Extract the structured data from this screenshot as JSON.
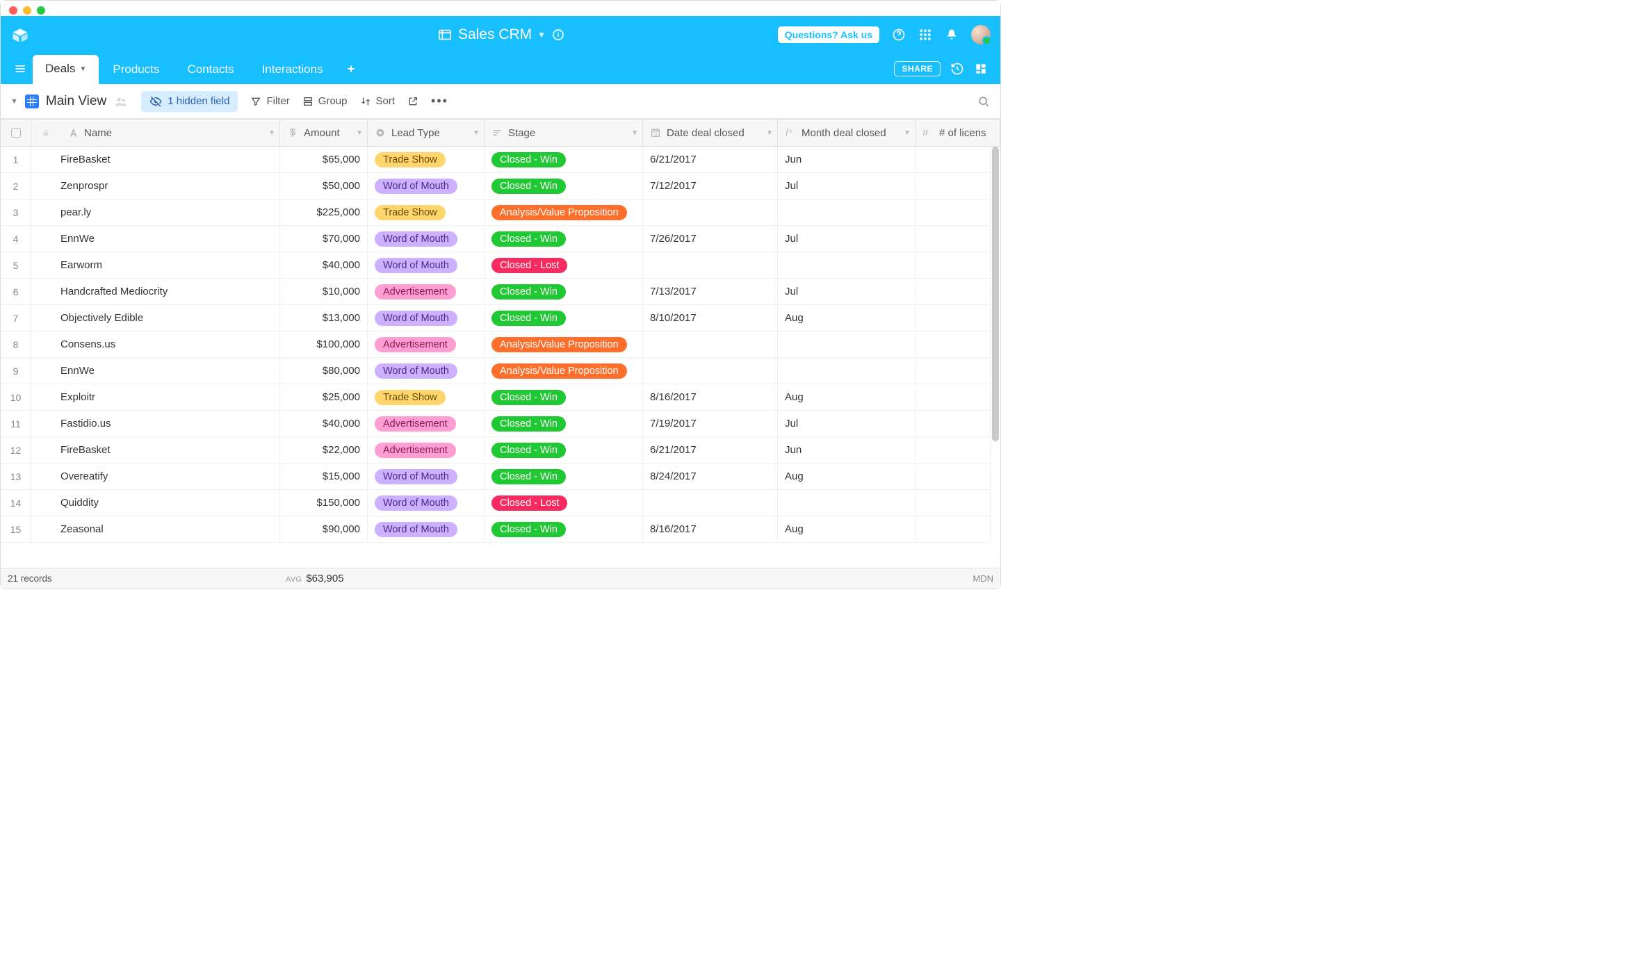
{
  "app": {
    "title": "Sales CRM"
  },
  "header": {
    "ask_label": "Questions? Ask us"
  },
  "tabs": {
    "items": [
      "Deals",
      "Products",
      "Contacts",
      "Interactions"
    ],
    "active": "Deals",
    "share_label": "SHARE"
  },
  "toolbar": {
    "view_name": "Main View",
    "hidden_fields": "1 hidden field",
    "filter": "Filter",
    "group": "Group",
    "sort": "Sort"
  },
  "columns": {
    "name": "Name",
    "amount": "Amount",
    "lead": "Lead Type",
    "stage": "Stage",
    "date": "Date deal closed",
    "month": "Month deal closed",
    "licenses": "# of licens"
  },
  "lead_classes": {
    "Trade Show": "lead-trade",
    "Word of Mouth": "lead-word",
    "Advertisement": "lead-ad"
  },
  "stage_classes": {
    "Closed - Win": "stage-win",
    "Closed - Lost": "stage-lost",
    "Analysis/Value Proposition": "stage-avp"
  },
  "rows": [
    {
      "n": 1,
      "name": "FireBasket",
      "amount": "$65,000",
      "lead": "Trade Show",
      "stage": "Closed - Win",
      "date": "6/21/2017",
      "month": "Jun"
    },
    {
      "n": 2,
      "name": "Zenprospr",
      "amount": "$50,000",
      "lead": "Word of Mouth",
      "stage": "Closed - Win",
      "date": "7/12/2017",
      "month": "Jul"
    },
    {
      "n": 3,
      "name": "pear.ly",
      "amount": "$225,000",
      "lead": "Trade Show",
      "stage": "Analysis/Value Proposition",
      "date": "",
      "month": ""
    },
    {
      "n": 4,
      "name": "EnnWe",
      "amount": "$70,000",
      "lead": "Word of Mouth",
      "stage": "Closed - Win",
      "date": "7/26/2017",
      "month": "Jul"
    },
    {
      "n": 5,
      "name": "Earworm",
      "amount": "$40,000",
      "lead": "Word of Mouth",
      "stage": "Closed - Lost",
      "date": "",
      "month": ""
    },
    {
      "n": 6,
      "name": "Handcrafted Mediocrity",
      "amount": "$10,000",
      "lead": "Advertisement",
      "stage": "Closed - Win",
      "date": "7/13/2017",
      "month": "Jul"
    },
    {
      "n": 7,
      "name": "Objectively Edible",
      "amount": "$13,000",
      "lead": "Word of Mouth",
      "stage": "Closed - Win",
      "date": "8/10/2017",
      "month": "Aug"
    },
    {
      "n": 8,
      "name": "Consens.us",
      "amount": "$100,000",
      "lead": "Advertisement",
      "stage": "Analysis/Value Proposition",
      "date": "",
      "month": ""
    },
    {
      "n": 9,
      "name": "EnnWe",
      "amount": "$80,000",
      "lead": "Word of Mouth",
      "stage": "Analysis/Value Proposition",
      "date": "",
      "month": ""
    },
    {
      "n": 10,
      "name": "Exploitr",
      "amount": "$25,000",
      "lead": "Trade Show",
      "stage": "Closed - Win",
      "date": "8/16/2017",
      "month": "Aug"
    },
    {
      "n": 11,
      "name": "Fastidio.us",
      "amount": "$40,000",
      "lead": "Advertisement",
      "stage": "Closed - Win",
      "date": "7/19/2017",
      "month": "Jul"
    },
    {
      "n": 12,
      "name": "FireBasket",
      "amount": "$22,000",
      "lead": "Advertisement",
      "stage": "Closed - Win",
      "date": "6/21/2017",
      "month": "Jun"
    },
    {
      "n": 13,
      "name": "Overeatify",
      "amount": "$15,000",
      "lead": "Word of Mouth",
      "stage": "Closed - Win",
      "date": "8/24/2017",
      "month": "Aug"
    },
    {
      "n": 14,
      "name": "Quiddity",
      "amount": "$150,000",
      "lead": "Word of Mouth",
      "stage": "Closed - Lost",
      "date": "",
      "month": ""
    },
    {
      "n": 15,
      "name": "Zeasonal",
      "amount": "$90,000",
      "lead": "Word of Mouth",
      "stage": "Closed - Win",
      "date": "8/16/2017",
      "month": "Aug"
    }
  ],
  "footer": {
    "records": "21 records",
    "avg_label": "AVG",
    "avg_value": "$63,905",
    "brand": "MDN"
  }
}
